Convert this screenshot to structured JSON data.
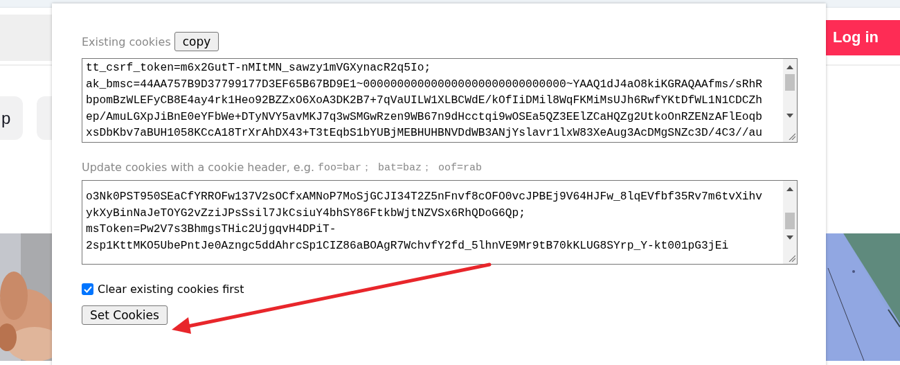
{
  "page": {
    "login_button": "Log in",
    "chips": [
      {
        "kind": "labeled",
        "label": "p"
      },
      {
        "kind": "covered"
      }
    ]
  },
  "dialog": {
    "existing_label": "Existing cookies",
    "copy_button": "copy",
    "existing_cookies": [
      "tt_csrf_token=m6x2GutT-nMItMN_sawzy1mVGXynacR2q5Io;",
      "ak_bmsc=44AA757B9D37799177D3EF65B67BD9E1~000000000000000000000000000000~YAAQ1dJ4aO8kiKGRAQAAfms/sRhR",
      "bpomBzWLEFyCB8E4ay4rk1Heo92BZZxO6XoA3DK2B7+7qVaUILW1XLBCWdE/kOfIiDMil8WqFKMiMsUJh6RwfYKtDfWL1N1CDCZh",
      "ep/AmuLGXpJiBnE0eYFbWe+DTyNVY5avMKJ7q3wSMGwRzen9WB67n9dHcctqi9wOSEa5QZ3EElZCaHQZg2UtkoOnRZENzAFlEoqb",
      "xsDbKbv7aBUH1058KCcA18TrXrAhDX43+T3tEqbS1bYUBjMEBHUHBNVDdWB3ANjYslavr1lxW83XeAug3AcDMgSNZc3D/4C3//au"
    ],
    "update_label": "Update cookies with a cookie header, e.g.",
    "update_example": "foo=bar； bat=baz； oof=rab",
    "update_cookies": [
      "o3Nk0PST950SEaCfYRROFw137V2sOCfxAMNoP7MoSjGCJI34T2Z5nFnvf8cOFO0vcJPBEj9V64HJFw_8lqEVfbf35Rv7m6tvXihv",
      "ykXyBinNaJeTOYG2vZziJPsSsil7JkCsiuY4bhSY86FtkbWjtNZVSx6RhQDoG6Qp;",
      "msToken=Pw2V7s3BhmgsTHic2UjgqvH4DPiT-",
      "2sp1KttMKO5UbePntJe0Azngc5ddAhrcSp1CIZ86aBOAgR7WchvfY2fd_5lhnVE9Mr9tB70kKLUG8SYrp_Y-kt001pG3jEi"
    ],
    "clear_first": {
      "label": "Clear existing cookies first",
      "checked": true
    },
    "set_button": "Set Cookies"
  }
}
